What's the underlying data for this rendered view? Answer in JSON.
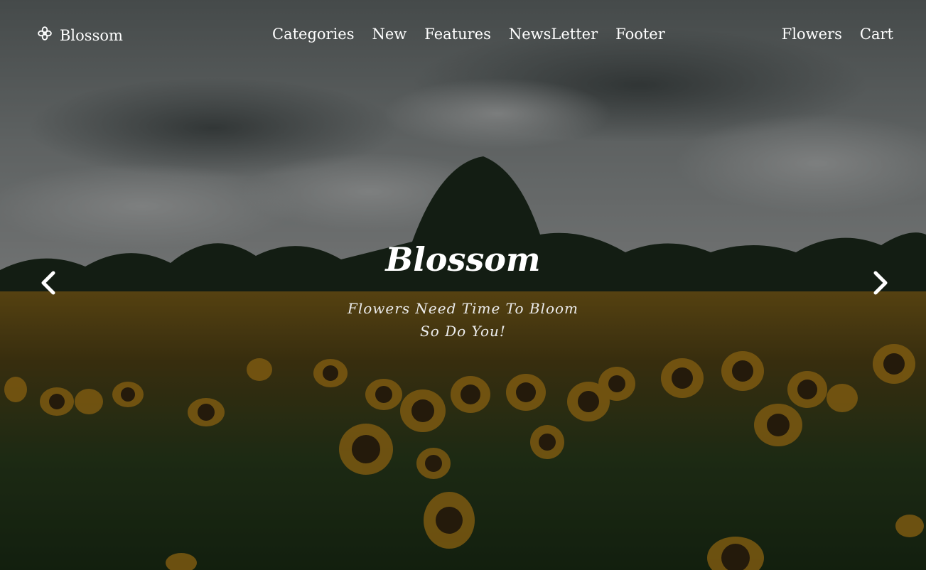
{
  "brand": {
    "name": "Blossom",
    "icon": "flower-icon"
  },
  "nav": {
    "items": [
      "Categories",
      "New",
      "Features",
      "NewsLetter",
      "Footer"
    ],
    "right": [
      "Flowers",
      "Cart"
    ]
  },
  "hero": {
    "title": "Blossom",
    "subtitle_line1": "Flowers Need Time To Bloom",
    "subtitle_line2": "So Do You!"
  },
  "carousel": {
    "prev_icon": "chevron-left-icon",
    "next_icon": "chevron-right-icon"
  }
}
